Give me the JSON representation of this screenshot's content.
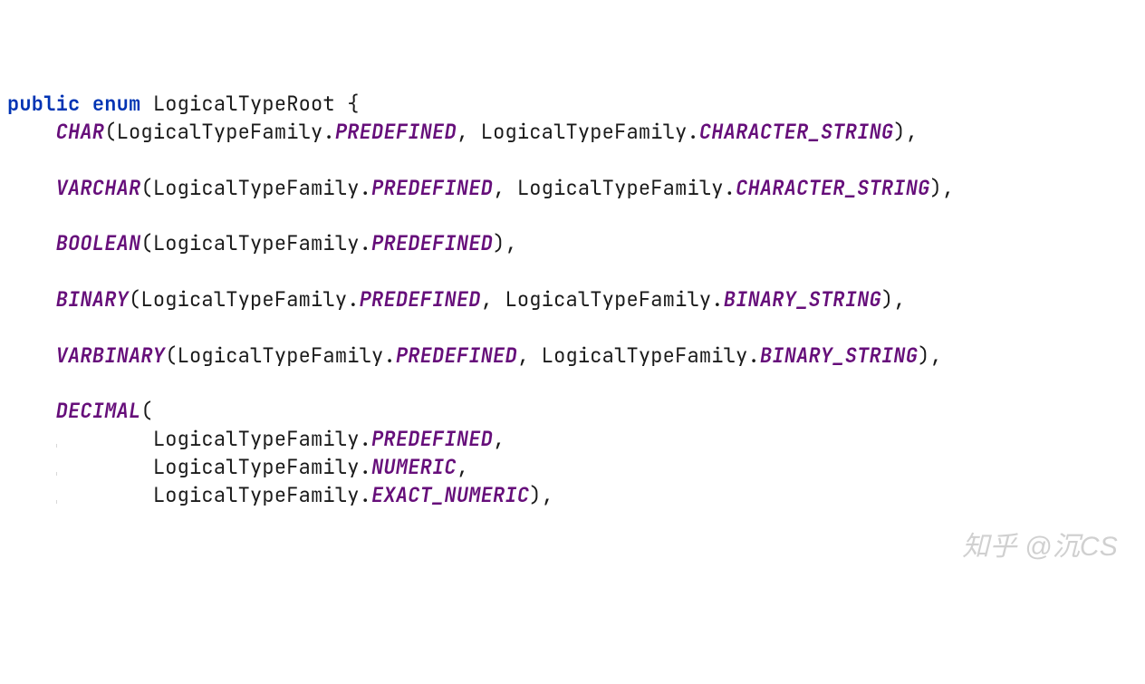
{
  "code": {
    "kw_public": "public",
    "kw_enum": "enum",
    "class_name": "LogicalTypeRoot",
    "open_brace": "{",
    "type_family": "LogicalTypeFamily",
    "dot": ".",
    "comma": ",",
    "open_paren": "(",
    "close_paren": ")",
    "close_paren_comma": "),",
    "constants": {
      "CHAR": "CHAR",
      "VARCHAR": "VARCHAR",
      "BOOLEAN": "BOOLEAN",
      "BINARY": "BINARY",
      "VARBINARY": "VARBINARY",
      "DECIMAL": "DECIMAL"
    },
    "fields": {
      "PREDEFINED": "PREDEFINED",
      "CHARACTER_STRING": "CHARACTER_STRING",
      "BINARY_STRING": "BINARY_STRING",
      "NUMERIC": "NUMERIC",
      "EXACT_NUMERIC": "EXACT_NUMERIC"
    }
  },
  "watermark": "知乎 @沉CS"
}
